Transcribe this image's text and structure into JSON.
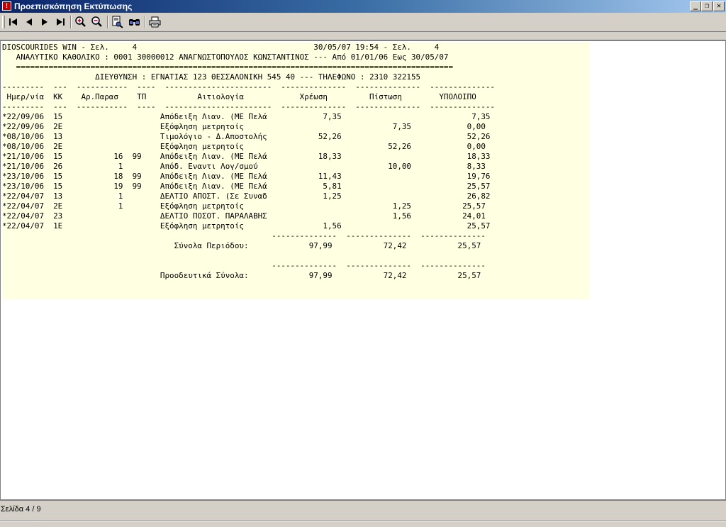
{
  "window": {
    "title": "Προεπισκόπηση Εκτύπωσης",
    "minimize": "_",
    "restore": "❐",
    "close": "✕",
    "app_icon": "printer-app-icon"
  },
  "toolbar": {
    "buttons": [
      "first-page-icon",
      "prev-page-icon",
      "next-page-icon",
      "last-page-icon",
      "zoom-in-icon",
      "zoom-out-icon",
      "find-icon",
      "find-next-icon",
      "print-icon"
    ]
  },
  "report": {
    "lines": [
      "DIOSCOURIDES WIN - Σελ.     4                                      30/05/07 19:54 - Σελ.     4",
      "   ΑΝΑΛΥΤΙΚΟ ΚΑΘΟΛΙΚΟ : 0001 30000012 ΑΝΑΓΝΩΣΤΟΠΟΥΛΟΣ ΚΩΝΣΤΑΝΤΙΝΟΣ --- Από 01/01/06 Εως 30/05/07",
      "   ==============================================================================================",
      "                    ΔΙΕΥΘΥΝΣΗ : ΕΓΝΑΤΙΑΣ 123 ΘΕΣΣΑΛΟΝΙΚΗ 545 40 --- ΤΗΛΕΦΩΝΟ : 2310 322155",
      "---------  ---  -----------  ----  -----------------------  --------------  --------------  --------------",
      " Ημερ/νία  KK    Αρ.Παρασ    ΤΠ           Αιτιολογία            Χρέωση         Πίστωση        ΥΠΟΛΟΙΠΟ",
      "---------  ---  -----------  ----  -----------------------  --------------  --------------  --------------",
      "*22/09/06  15                     Απόδειξη Λιαν. (ΜΕ Πελά            7,35                            7,35",
      "*22/09/06  2E                     Εξόφληση μετρητοίς                                7,35            0,00",
      "*08/10/06  13                     Τιμολόγιο - Δ.Αποστολής           52,26                           52,26",
      "*08/10/06  2E                     Εξόφληση μετρητοίς                               52,26            0,00",
      "*21/10/06  15           16  99    Απόδειξη Λιαν. (ΜΕ Πελά           18,33                           18,33",
      "*21/10/06  26            1        Απόδ. Εναντι Λογ/σμού                            10,00            8,33",
      "*23/10/06  15           18  99    Απόδειξη Λιαν. (ΜΕ Πελά           11,43                           19,76",
      "*23/10/06  15           19  99    Απόδειξη Λιαν. (ΜΕ Πελά            5,81                           25,57",
      "*22/04/07  13            1        ΔΕΛΤΙΟ ΑΠΟΣΤ. (Σε Συναδ            1,25                           26,82",
      "*22/04/07  2E            1        Εξόφληση μετρητοίς                                1,25           25,57",
      "*22/04/07  23                     ΔΕΛΤΙΟ ΠΟΣΟΤ. ΠΑΡΑΛΑΒΗΣ                           1,56           24,01",
      "*22/04/07  1E                     Εξόφληση μετρητοίς                 1,56                           25,57",
      "                                                          --------------  --------------  --------------",
      "                                     Σύνολα Περιόδου:             97,99           72,42           25,57",
      "",
      "                                                          --------------  --------------  --------------",
      "                                  Προοδευτικά Σύνολα:             97,99           72,42           25,57"
    ]
  },
  "status": {
    "page_text": "Σελίδα 4 / 9"
  }
}
